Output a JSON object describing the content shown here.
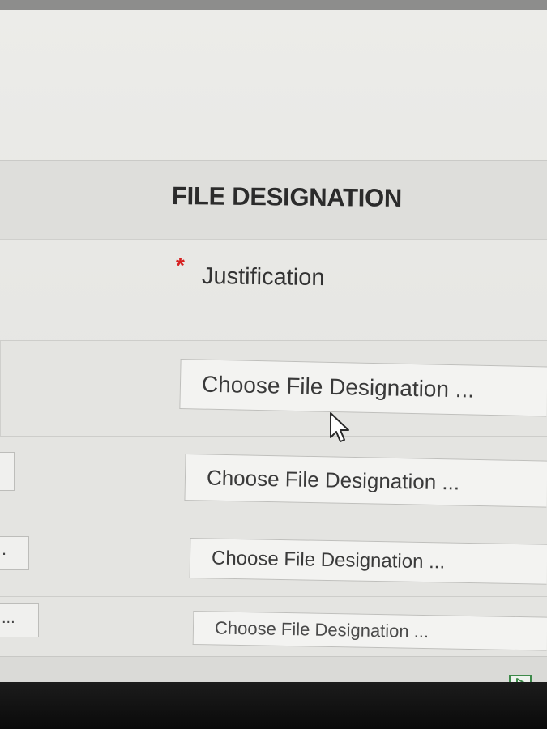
{
  "section": {
    "title": "FILE DESIGNATION"
  },
  "justification": {
    "required_marker": "*",
    "label": "Justification"
  },
  "file_designation_rows": [
    {
      "button_label": "Choose File Designation ...",
      "left_value": ""
    },
    {
      "button_label": "Choose File Designation ...",
      "left_value": ""
    },
    {
      "button_label": "Choose File Designation ...",
      "left_value": "."
    },
    {
      "button_label": "Choose File Designation ...",
      "left_value": "..."
    }
  ],
  "colors": {
    "required": "#d62020",
    "corner_icon": "#3e8a4a"
  },
  "icons": {
    "cursor": "mouse-pointer-icon",
    "corner": "play-icon"
  }
}
